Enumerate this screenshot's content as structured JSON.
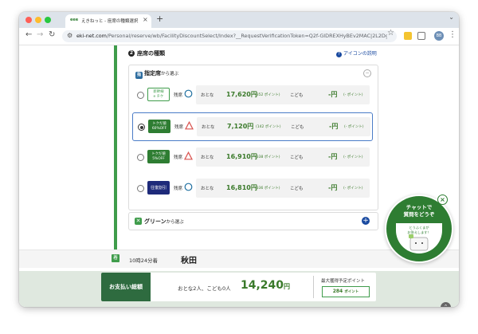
{
  "browser": {
    "tab_favicon": "eee",
    "tab_title": "えきねっと - 座席の種類選択 | JRきっぷ",
    "tab_close": "×",
    "new_tab": "+",
    "url_domain": "eki-net.com",
    "url_path": "/Personal/reserve/wb/FacilityDiscountSelect/Index?__RequestVerificationToken=Q2f-GIDREXHyBEv2MAC|2L2DgHCm...",
    "profile_initials": "BB"
  },
  "section": {
    "number": "2",
    "title": "座席の種類",
    "help_link": "アイコンの説明"
  },
  "reserved_panel": {
    "heading_main": "指定席",
    "heading_suffix": "から選ぶ",
    "rows": [
      {
        "tag": "新幹線\ne チケ",
        "tag_style": "outline",
        "availability": "残席",
        "mark": "circle",
        "selected": false,
        "adult_label": "おとな",
        "adult_price": "17,620円",
        "adult_points": "(352 ポイント)",
        "child_label": "こども",
        "child_price": "-円",
        "child_points": "(- ポイント)"
      },
      {
        "tag": "トクだ値\n60%OFF",
        "tag_style": "green",
        "availability": "残席",
        "mark": "triangle",
        "selected": true,
        "adult_label": "おとな",
        "adult_price": "7,120円",
        "adult_points": "(142 ポイント)",
        "child_label": "こども",
        "child_price": "-円",
        "child_points": "(- ポイント)"
      },
      {
        "tag": "トクだ値\n5%OFF",
        "tag_style": "green",
        "availability": "残席",
        "mark": "triangle",
        "selected": false,
        "adult_label": "おとな",
        "adult_price": "16,910円",
        "adult_points": "(338 ポイント)",
        "child_label": "こども",
        "child_price": "-円",
        "child_points": "(- ポイント)"
      },
      {
        "tag": "往復割引",
        "tag_style": "navy",
        "availability": "残席",
        "mark": "circle",
        "selected": false,
        "adult_label": "おとな",
        "adult_price": "16,810円",
        "adult_points": "(336 ポイント)",
        "child_label": "こども",
        "child_price": "-円",
        "child_points": "(- ポイント)"
      }
    ]
  },
  "green_panel": {
    "heading_main": "グリーン",
    "heading_suffix": "から選ぶ"
  },
  "arrival": {
    "badge": "着",
    "time": "10時24分着",
    "station": "秋田"
  },
  "payment": {
    "label": "お支払い総額",
    "people": "おとな2人、こども0人",
    "amount": "14,240",
    "yen": "円",
    "points_label": "最大獲得予定ポイント",
    "points_value": "284",
    "points_unit": "ポイント"
  },
  "chat": {
    "title": "チャットで\n質問をどうぞ",
    "subtitle": "とうふくまが\nお答えします！"
  },
  "colors": {
    "brand_green": "#2e7d32",
    "price_green": "#3a7a2a",
    "link_blue": "#1a4aa0",
    "selected_border": "#4a7cc7"
  }
}
